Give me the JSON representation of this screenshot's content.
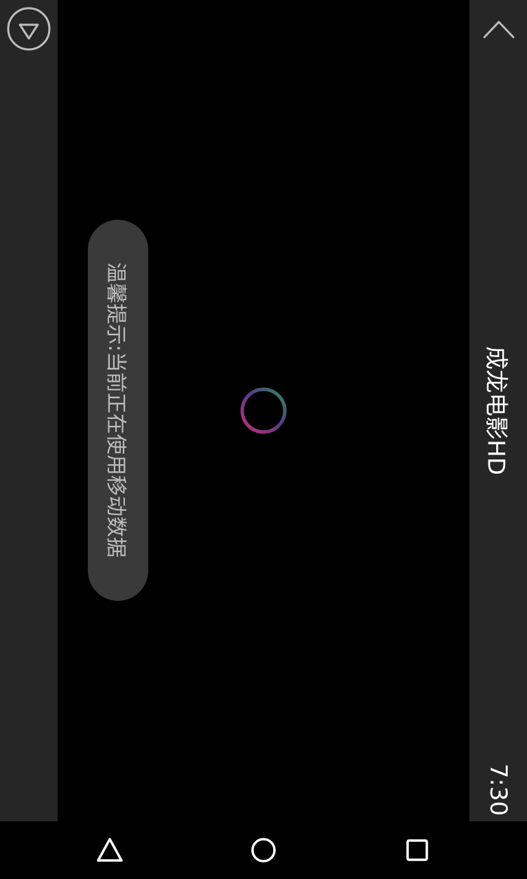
{
  "player": {
    "title": "成龙电影HD",
    "time": "7:30"
  },
  "toast": {
    "message": "温馨提示:当前正在使用移动数据"
  },
  "icons": {
    "collapse": "chevron-down-circle-icon",
    "expand": "chevron-up-icon",
    "spinner": "loading-spinner-icon",
    "back": "nav-back-icon",
    "home": "nav-home-icon",
    "recents": "nav-recents-icon"
  },
  "colors": {
    "panel": "#262626",
    "toast_bg": "#3a3a3a",
    "spinner_a": "#c2307a",
    "spinner_b": "#2e8b57"
  }
}
